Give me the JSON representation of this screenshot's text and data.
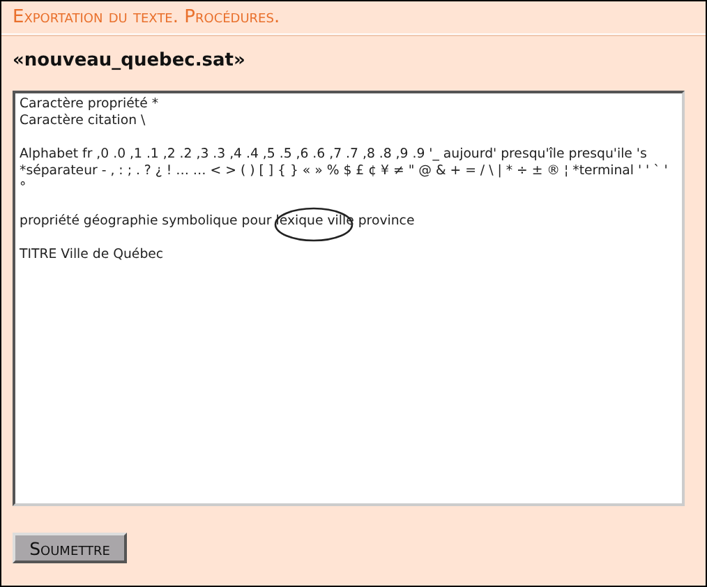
{
  "header": {
    "title": "Exportation du texte. Procédures."
  },
  "file_name": "«nouveau_quebec.sat»",
  "editor": {
    "value": "Caractère propriété *\nCaractère citation \\\n\nAlphabet fr ,0 .0 ,1 .1 ,2 .2 ,3 .3 ,4 .4 ,5 .5 ,6 .6 ,7 .7 ,8 .8 ,9 .9 '_ aujourd' presqu'île presqu'ile 's *séparateur - , : ; . ? ¿ ! … … < > ( ) [ ] { } « » % $ £ ¢ ¥ ≠ \" @ & + = / \\ | * ÷ ± ® ¦ *terminal ' ' ` ' °\n\npropriété géographie symbolique pour lexique ville province\n\nTITRE Ville de Québec"
  },
  "submit_button": {
    "label": "Soumettre"
  }
}
